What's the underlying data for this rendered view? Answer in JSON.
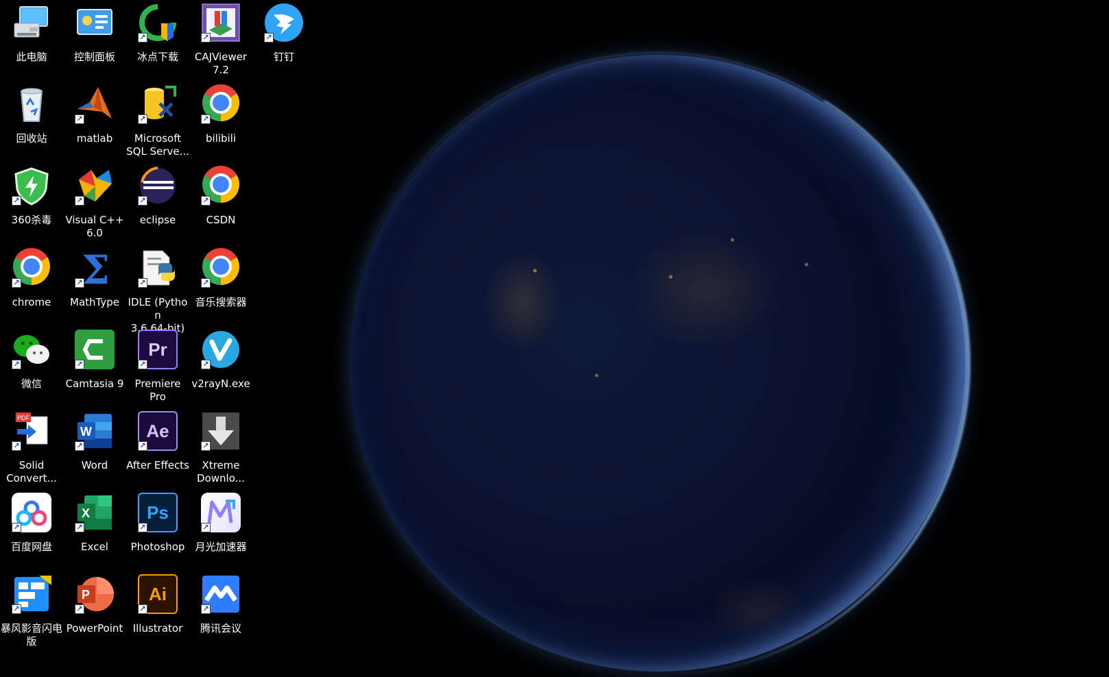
{
  "desktop": {
    "icons": [
      {
        "label": "此电脑",
        "icon": "computer-icon"
      },
      {
        "label": "控制面板",
        "icon": "control-panel-icon"
      },
      {
        "label": "冰点下载",
        "icon": "bingdian-download-icon"
      },
      {
        "label": "CAJViewer\n7.2",
        "icon": "cajviewer-icon"
      },
      {
        "label": "钉钉",
        "icon": "dingtalk-icon"
      },
      {
        "label": "回收站",
        "icon": "recycle-bin-icon"
      },
      {
        "label": "matlab",
        "icon": "matlab-icon"
      },
      {
        "label": "Microsoft\nSQL Serve...",
        "icon": "sql-server-icon"
      },
      {
        "label": "bilibili",
        "icon": "chrome-icon"
      },
      {
        "label": "360杀毒",
        "icon": "360-antivirus-icon"
      },
      {
        "label": "Visual C++\n6.0",
        "icon": "visual-cpp-icon"
      },
      {
        "label": "eclipse",
        "icon": "eclipse-icon"
      },
      {
        "label": "CSDN",
        "icon": "chrome-icon"
      },
      {
        "label": "chrome",
        "icon": "chrome-icon"
      },
      {
        "label": "MathType",
        "icon": "mathtype-icon"
      },
      {
        "label": "IDLE (Python\n3.6 64-bit)",
        "icon": "python-idle-icon"
      },
      {
        "label": "音乐搜索器",
        "icon": "chrome-icon"
      },
      {
        "label": "微信",
        "icon": "wechat-icon"
      },
      {
        "label": "Camtasia 9",
        "icon": "camtasia-icon"
      },
      {
        "label": "Premiere\nPro",
        "icon": "premiere-pro-icon"
      },
      {
        "label": "v2rayN.exe",
        "icon": "v2rayn-icon"
      },
      {
        "label": "Solid\nConvert...",
        "icon": "solid-converter-icon"
      },
      {
        "label": "Word",
        "icon": "word-icon"
      },
      {
        "label": "After Effects",
        "icon": "after-effects-icon"
      },
      {
        "label": "Xtreme\nDownlo...",
        "icon": "xtreme-download-icon"
      },
      {
        "label": "百度网盘",
        "icon": "baidu-netdisk-icon"
      },
      {
        "label": "Excel",
        "icon": "excel-icon"
      },
      {
        "label": "Photoshop",
        "icon": "photoshop-icon"
      },
      {
        "label": "月光加速器",
        "icon": "moonlight-accelerator-icon"
      },
      {
        "label": "暴风影音闪电\n版",
        "icon": "baofeng-player-icon"
      },
      {
        "label": "PowerPoint",
        "icon": "powerpoint-icon"
      },
      {
        "label": "Illustrator",
        "icon": "illustrator-icon"
      },
      {
        "label": "腾讯会议",
        "icon": "tencent-meeting-icon"
      }
    ]
  },
  "colors": {
    "background": "#000000",
    "label_text": "#ffffff",
    "earth_glow": "#8cc0ff"
  }
}
